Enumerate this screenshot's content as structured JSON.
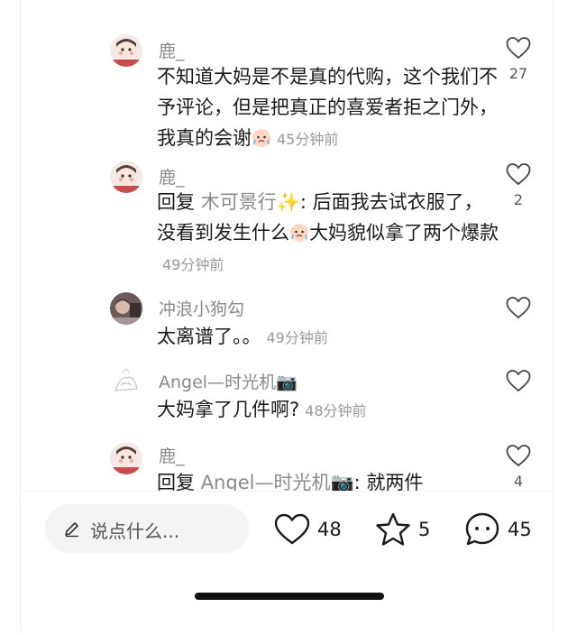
{
  "comments": [
    {
      "username": "鹿_",
      "text": "不知道大妈是不是真的代购，这个我们不予评论，但是把真正的喜爱者拒之门外，我真的会谢",
      "time": "45分钟前",
      "likes": "27"
    },
    {
      "username": "鹿_",
      "reply_prefix": "回复",
      "reply_to": "木可景行✨",
      "text_part1": ": 后面我去试衣服了，没看到发生什么",
      "text_part2": "大妈貌似拿了两个爆款",
      "time": "49分钟前",
      "likes": "2"
    },
    {
      "username": "冲浪小狗勾",
      "text": "太离谱了。。",
      "time": "49分钟前"
    },
    {
      "username": "Angel—时光机📷",
      "text": "大妈拿了几件啊?",
      "time": "48分钟前"
    },
    {
      "username": "鹿_",
      "reply_prefix": "回复",
      "reply_to": "Angel—时光机📷",
      "text": ": 就两件",
      "likes": "4"
    }
  ],
  "bottom_bar": {
    "input_placeholder": "说点什么...",
    "like_count": "48",
    "star_count": "5",
    "comment_count": "45"
  },
  "colors": {
    "secondary_text": "#8a8a8a",
    "primary_text": "#1a1a1a",
    "input_bg": "#f4f4f4"
  }
}
